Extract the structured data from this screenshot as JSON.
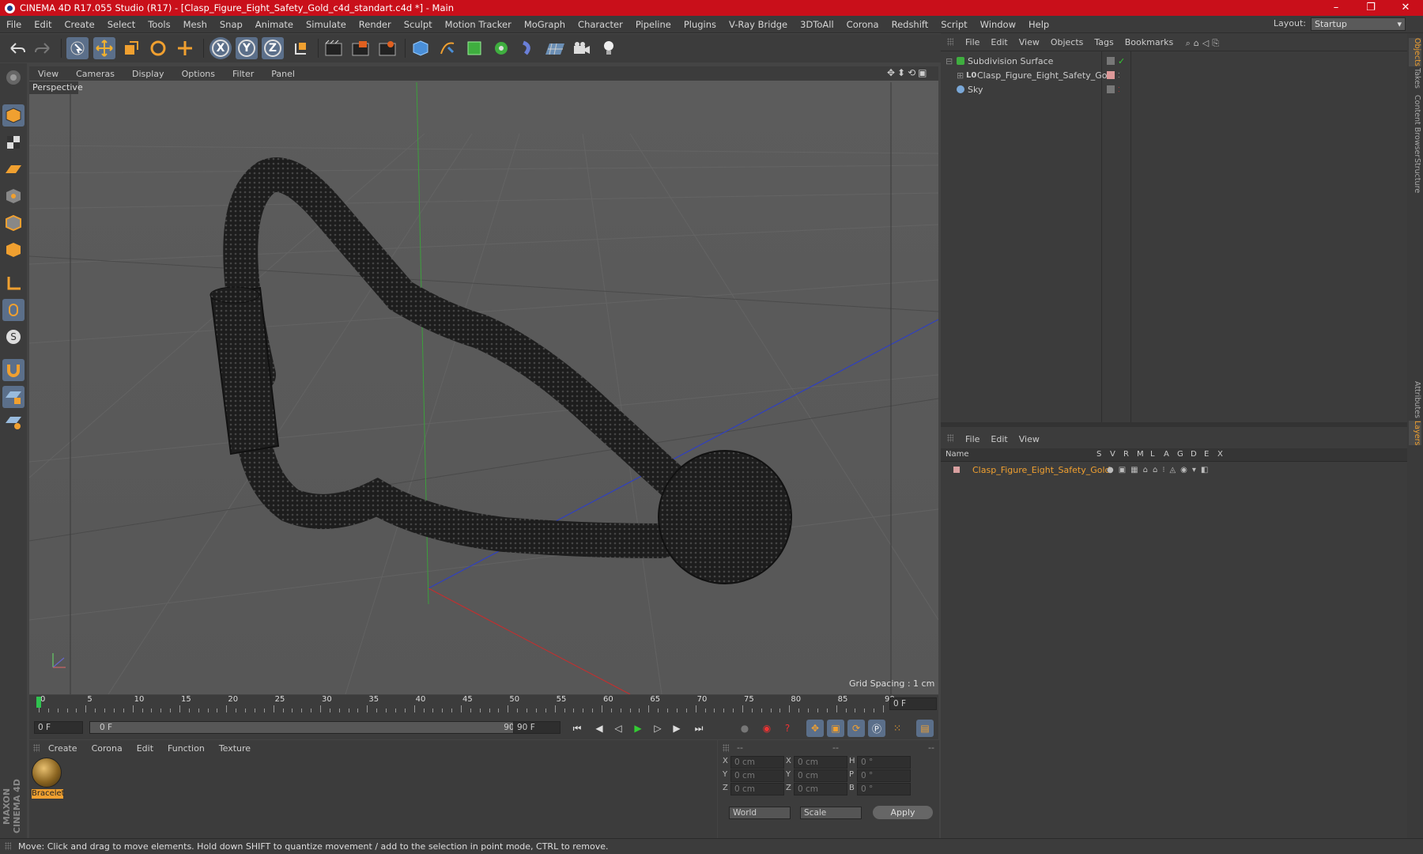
{
  "window": {
    "title": "CINEMA 4D R17.055 Studio (R17) - [Clasp_Figure_Eight_Safety_Gold_c4d_standart.c4d *] - Main",
    "minimize": "–",
    "maximize": "❐",
    "close": "✕"
  },
  "menu": [
    "File",
    "Edit",
    "Create",
    "Select",
    "Tools",
    "Mesh",
    "Snap",
    "Animate",
    "Simulate",
    "Render",
    "Sculpt",
    "Motion Tracker",
    "MoGraph",
    "Character",
    "Pipeline",
    "Plugins",
    "V-Ray Bridge",
    "3DToAll",
    "Corona",
    "Redshift",
    "Script",
    "Window",
    "Help"
  ],
  "layout": {
    "label": "Layout:",
    "value": "Startup"
  },
  "toolbar": {
    "x": "X",
    "y": "Y",
    "z": "Z"
  },
  "viewport": {
    "menu": [
      "View",
      "Cameras",
      "Display",
      "Options",
      "Filter",
      "Panel"
    ],
    "label": "Perspective",
    "grid_spacing": "Grid Spacing : 1 cm"
  },
  "timeline": {
    "ticks": [
      "0",
      "5",
      "10",
      "15",
      "20",
      "25",
      "30",
      "35",
      "40",
      "45",
      "50",
      "55",
      "60",
      "65",
      "70",
      "75",
      "80",
      "85",
      "90"
    ],
    "current_frame": "0 F",
    "start": "0 F",
    "slider_left": "0 F",
    "slider_right": "90 F",
    "end": "90 F"
  },
  "materials": {
    "menu": [
      "Create",
      "Corona",
      "Edit",
      "Function",
      "Texture"
    ],
    "items": [
      {
        "name": "Bracelet"
      }
    ]
  },
  "coords": {
    "header": [
      "--",
      "--",
      "--"
    ],
    "rows": [
      {
        "a": "X",
        "av": "0 cm",
        "b": "X",
        "bv": "0 cm",
        "c": "H",
        "cv": "0 °"
      },
      {
        "a": "Y",
        "av": "0 cm",
        "b": "Y",
        "bv": "0 cm",
        "c": "P",
        "cv": "0 °"
      },
      {
        "a": "Z",
        "av": "0 cm",
        "b": "Z",
        "bv": "0 cm",
        "c": "B",
        "cv": "0 °"
      }
    ],
    "mode1": "World",
    "mode2": "Scale",
    "apply": "Apply"
  },
  "objects": {
    "menu": [
      "File",
      "Edit",
      "View",
      "Objects",
      "Tags",
      "Bookmarks"
    ],
    "items": [
      {
        "name": "Subdivision Surface",
        "indent": 0
      },
      {
        "name": "Clasp_Figure_Eight_Safety_Gold",
        "indent": 1
      },
      {
        "name": "Sky",
        "indent": 0
      }
    ]
  },
  "layers": {
    "menu": [
      "File",
      "Edit",
      "View"
    ],
    "columns": [
      "Name",
      "S",
      "V",
      "R",
      "M",
      "L",
      "A",
      "G",
      "D",
      "E",
      "X"
    ],
    "items": [
      {
        "name": "Clasp_Figure_Eight_Safety_Gold"
      }
    ]
  },
  "sidetabs": [
    "Objects",
    "Takes",
    "Content Browser",
    "Structure",
    "Attributes",
    "Layers"
  ],
  "status": "Move: Click and drag to move elements. Hold down SHIFT to quantize movement / add to the selection in point mode, CTRL to remove.",
  "brand": "MAXON CINEMA 4D",
  "colors": {
    "title_bar": "#c90f1a",
    "accent_orange": "#f0a030",
    "selected_tool": "#5b6f8a"
  }
}
